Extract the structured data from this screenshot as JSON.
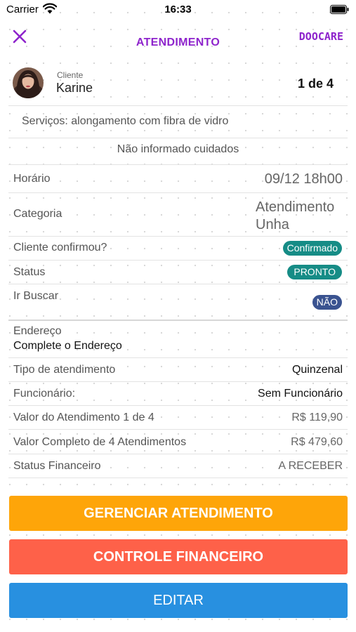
{
  "status_bar": {
    "carrier": "Carrier",
    "time": "16:33"
  },
  "nav": {
    "title": "ATENDIMENTO",
    "brand": "DOOCARE",
    "close_icon": "close-icon"
  },
  "client": {
    "caption": "Cliente",
    "name": "Karine",
    "count": "1 de 4"
  },
  "services": "Serviços: alongamento com fibra de vidro",
  "care_note": "Não informado cuidados",
  "details": {
    "horario": {
      "label": "Horário",
      "value": "09/12 18h00"
    },
    "categoria": {
      "label": "Categoria",
      "value_line1": "Atendimento",
      "value_line2": "Unha"
    },
    "cliente_confirmou": {
      "label": "Cliente confirmou?",
      "value": "Confirmado"
    },
    "status": {
      "label": "Status",
      "value": "PRONTO"
    },
    "ir_buscar": {
      "label": "Ir Buscar",
      "value": "NÃO"
    },
    "endereco": {
      "label": "Endereço",
      "value": "Complete o Endereço"
    },
    "tipo": {
      "label": "Tipo de atendimento",
      "value": "Quinzenal"
    },
    "funcionario": {
      "label": "Funcionário:",
      "value": "Sem Funcionário"
    },
    "valor_atendimento": {
      "label": "Valor do Atendimento 1 de 4",
      "value": "R$ 119,90"
    },
    "valor_completo": {
      "label": "Valor Completo de 4 Atendimentos",
      "value": "R$ 479,60"
    },
    "status_financeiro": {
      "label": "Status Financeiro",
      "value": "A RECEBER"
    }
  },
  "buttons": {
    "manage": "GERENCIAR ATENDIMENTO",
    "finance": "CONTROLE FINANCEIRO",
    "edit": "EDITAR"
  },
  "colors": {
    "purple": "#8e24cc",
    "teal_badge": "#168c86",
    "navy_badge": "#3a5390",
    "manage_button": "#fea509",
    "finance_button": "#fe6149",
    "edit_button": "#2890e0"
  }
}
